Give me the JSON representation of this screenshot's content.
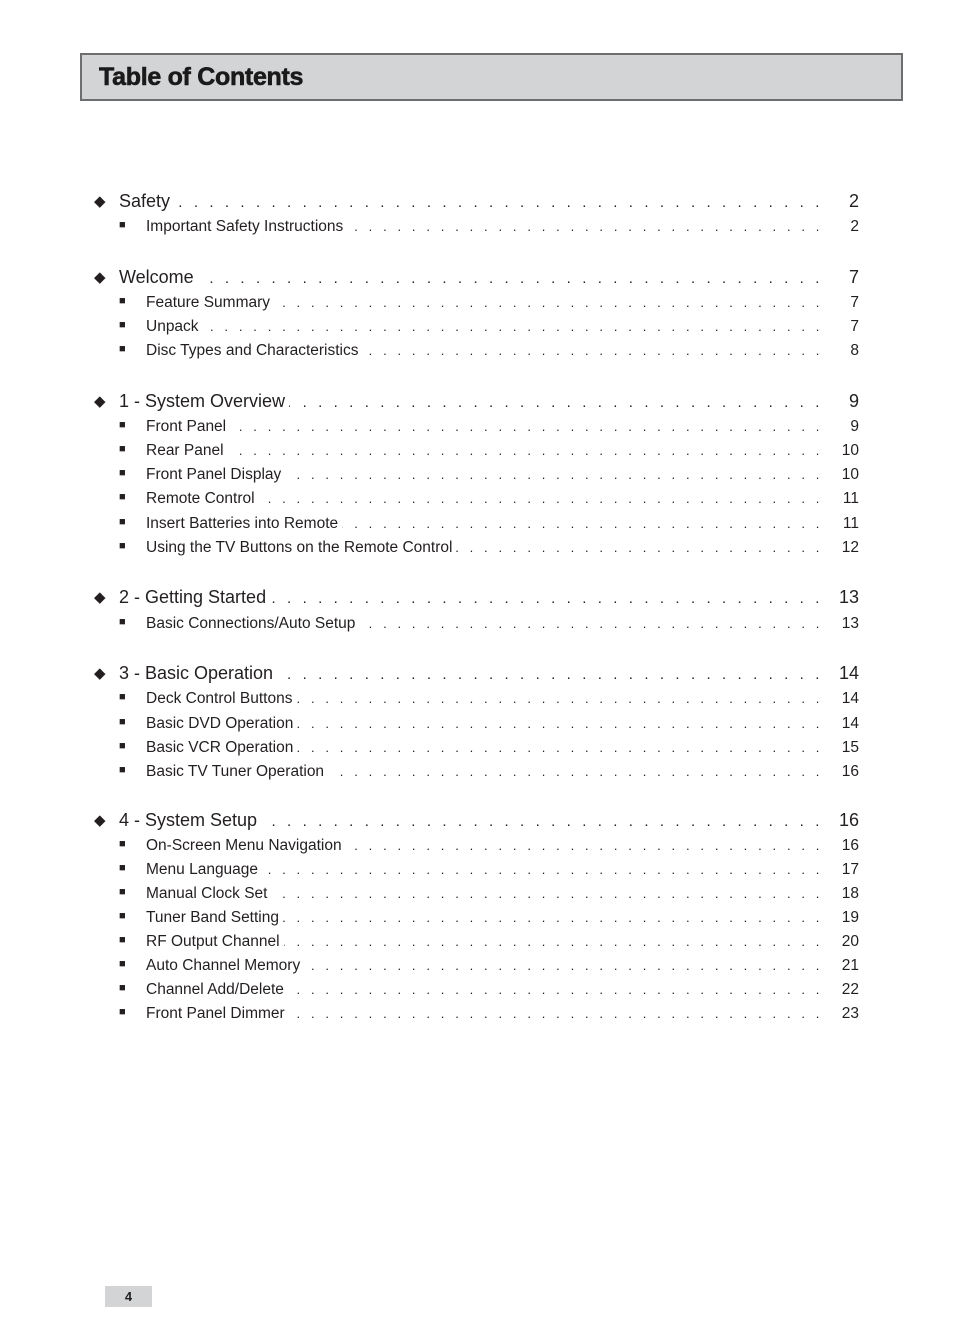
{
  "header": {
    "title": "Table of Contents"
  },
  "icons": {
    "section_bullet": "diamond-icon",
    "item_bullet": "square-icon"
  },
  "toc": [
    {
      "type": "main",
      "label": "Safety",
      "page": "2"
    },
    {
      "type": "sub",
      "label": "Important Safety Instructions",
      "page": "2"
    },
    {
      "type": "main",
      "label": "Welcome",
      "page": "7"
    },
    {
      "type": "sub",
      "label": "Feature Summary",
      "page": "7"
    },
    {
      "type": "sub",
      "label": "Unpack",
      "page": "7"
    },
    {
      "type": "sub",
      "label": "Disc Types and Characteristics",
      "page": "8"
    },
    {
      "type": "main",
      "label": "1 - System Overview",
      "page": "9"
    },
    {
      "type": "sub",
      "label": "Front Panel",
      "page": "9"
    },
    {
      "type": "sub",
      "label": "Rear Panel",
      "page": "10"
    },
    {
      "type": "sub",
      "label": "Front Panel Display",
      "page": "10"
    },
    {
      "type": "sub",
      "label": "Remote Control",
      "page": "11"
    },
    {
      "type": "sub",
      "label": "Insert Batteries into Remote",
      "page": "11"
    },
    {
      "type": "sub",
      "label": "Using the TV Buttons on the Remote Control",
      "page": "12"
    },
    {
      "type": "main",
      "label": "2 - Getting Started",
      "page": "13"
    },
    {
      "type": "sub",
      "label": "Basic Connections/Auto Setup",
      "page": "13"
    },
    {
      "type": "main",
      "label": "3 - Basic Operation",
      "page": "14"
    },
    {
      "type": "sub",
      "label": "Deck Control Buttons",
      "page": "14"
    },
    {
      "type": "sub",
      "label": "Basic DVD Operation",
      "page": "14"
    },
    {
      "type": "sub",
      "label": "Basic VCR Operation",
      "page": "15"
    },
    {
      "type": "sub",
      "label": "Basic TV Tuner Operation",
      "page": "16"
    },
    {
      "type": "main",
      "label": "4 - System Setup",
      "page": "16"
    },
    {
      "type": "sub",
      "label": "On-Screen Menu Navigation",
      "page": "16"
    },
    {
      "type": "sub",
      "label": "Menu Language",
      "page": "17"
    },
    {
      "type": "sub",
      "label": "Manual Clock Set",
      "page": "18"
    },
    {
      "type": "sub",
      "label": "Tuner Band Setting",
      "page": "19"
    },
    {
      "type": "sub",
      "label": "RF Output Channel",
      "page": "20"
    },
    {
      "type": "sub",
      "label": "Auto Channel Memory",
      "page": "21"
    },
    {
      "type": "sub",
      "label": "Channel Add/Delete",
      "page": "22"
    },
    {
      "type": "sub",
      "label": "Front Panel Dimmer",
      "page": "23"
    }
  ],
  "footer": {
    "page_number": "4"
  }
}
